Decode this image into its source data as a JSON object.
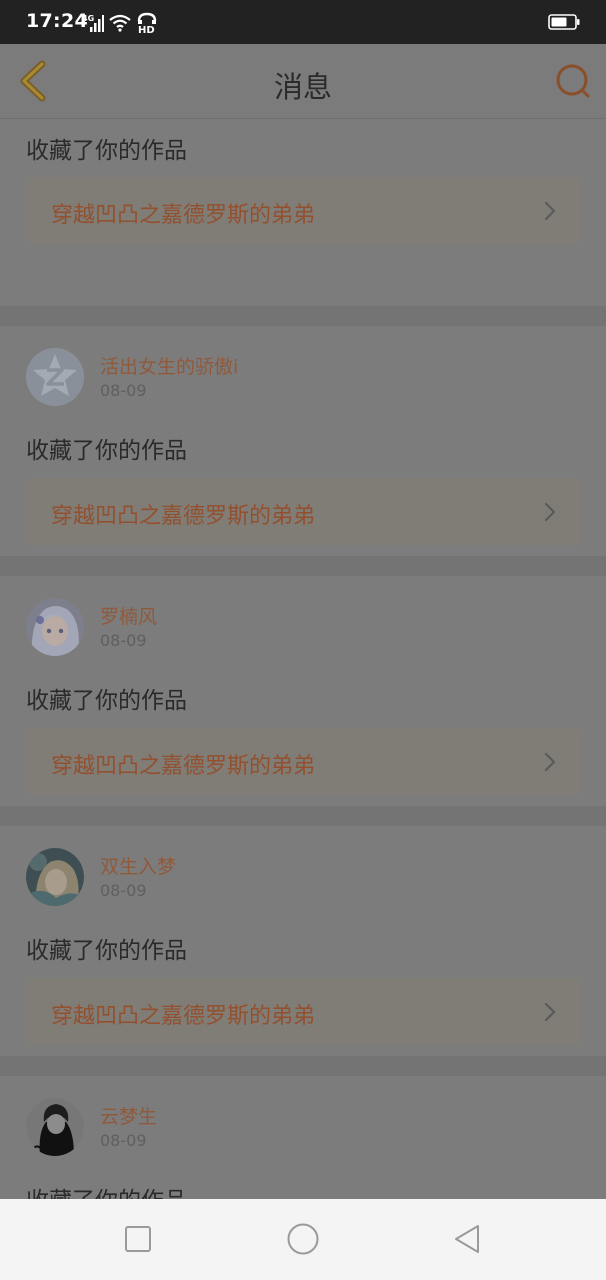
{
  "status": {
    "time": "17:24",
    "network": "4G",
    "hd": "HD"
  },
  "nav": {
    "title": "消息",
    "back_icon": "chevron-left-icon",
    "search_icon": "search-icon"
  },
  "colors": {
    "accent": "#e8722a",
    "link_text": "#93502f",
    "username": "#8f5a3c"
  },
  "feed": [
    {
      "action": "收藏了你的作品",
      "work_title": "穿越凹凸之嘉德罗斯的弟弟"
    },
    {
      "username": "活出女生的骄傲i",
      "date": "08-09",
      "avatar": "default-avatar",
      "action": "收藏了你的作品",
      "work_title": "穿越凹凸之嘉德罗斯的弟弟"
    },
    {
      "username": "罗楠风",
      "date": "08-09",
      "avatar": "anime-girl-avatar",
      "action": "收藏了你的作品",
      "work_title": "穿越凹凸之嘉德罗斯的弟弟"
    },
    {
      "username": "双生入梦",
      "date": "08-09",
      "avatar": "anime-portrait-avatar",
      "action": "收藏了你的作品",
      "work_title": "穿越凹凸之嘉德罗斯的弟弟"
    },
    {
      "username": "云梦生",
      "date": "08-09",
      "avatar": "dark-character-avatar",
      "action": "收藏了你的作品",
      "work_title": ""
    }
  ],
  "system_nav": {
    "recents": "square-icon",
    "home": "circle-icon",
    "back": "triangle-back-icon"
  }
}
